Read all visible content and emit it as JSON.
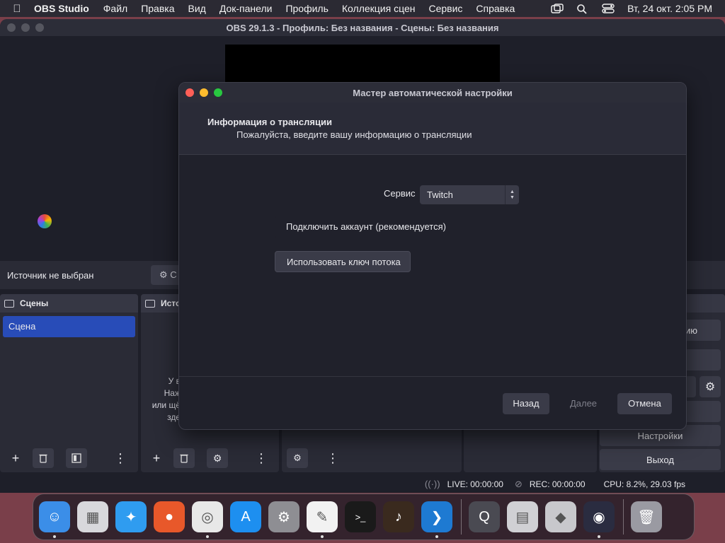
{
  "menubar": {
    "app_name": "OBS Studio",
    "items": [
      "Файл",
      "Правка",
      "Вид",
      "Док-панели",
      "Профиль",
      "Коллекция сцен",
      "Сервис",
      "Справка"
    ],
    "clock": "Вт, 24 окт.  2:05 PM"
  },
  "main_window": {
    "title": "OBS 29.1.3 - Профиль: Без названия - Сцены: Без названия",
    "source_status": "Источник не выбран",
    "properties_label": "С",
    "scenes_dock": {
      "title": "Сцены",
      "items": [
        "Сцена"
      ]
    },
    "sources_dock": {
      "title": "Исто",
      "hint_lines": [
        "У в",
        "Наж",
        "или щё",
        "зде"
      ]
    },
    "controls": {
      "partial_1": "цию",
      "partial_2": "ь",
      "partial_3": "м",
      "settings": "Настройки",
      "exit": "Выход"
    },
    "status": {
      "live": "LIVE: 00:00:00",
      "rec": "REC: 00:00:00",
      "cpu": "CPU: 8.2%, 29.03 fps"
    }
  },
  "dialog": {
    "title": "Мастер автоматической настройки",
    "header_title": "Информация о трансляции",
    "header_subtitle": "Пожалуйста, введите вашу информацию о трансляции",
    "service_label": "Сервис",
    "service_value": "Twitch",
    "connect_account": "Подключить аккаунт (рекомендуется)",
    "use_stream_key": "Использовать ключ потока",
    "back": "Назад",
    "next": "Далее",
    "cancel": "Отмена"
  },
  "dock_apps": [
    {
      "name": "finder-icon",
      "color": "#3b8ee8"
    },
    {
      "name": "launchpad-icon",
      "color": "#d8d8dc"
    },
    {
      "name": "safari-icon",
      "color": "#2f9cf0"
    },
    {
      "name": "firefox-icon",
      "color": "#e8582a"
    },
    {
      "name": "chrome-icon",
      "color": "#e8e8e8"
    },
    {
      "name": "app-store-icon",
      "color": "#1d8ff0"
    },
    {
      "name": "system-settings-icon",
      "color": "#8e8e93"
    },
    {
      "name": "textedit-icon",
      "color": "#f2f2f2"
    },
    {
      "name": "terminal-icon",
      "color": "#1a1a1a"
    },
    {
      "name": "garageband-icon",
      "color": "#3a2a1e"
    },
    {
      "name": "vscode-icon",
      "color": "#1e7ad2"
    },
    {
      "name": "quicktime-icon",
      "color": "#4a4a52"
    },
    {
      "name": "calculator-icon",
      "color": "#d0d0d4"
    },
    {
      "name": "roblox-icon",
      "color": "#c8c8cc"
    },
    {
      "name": "obs-icon",
      "color": "#2a2c40"
    },
    {
      "name": "trash-icon",
      "color": "#9a9aa2"
    }
  ],
  "colors": {
    "accent_selected": "#284cb8",
    "dialog_bg": "#20212b",
    "button_bg": "#3a3b48"
  }
}
